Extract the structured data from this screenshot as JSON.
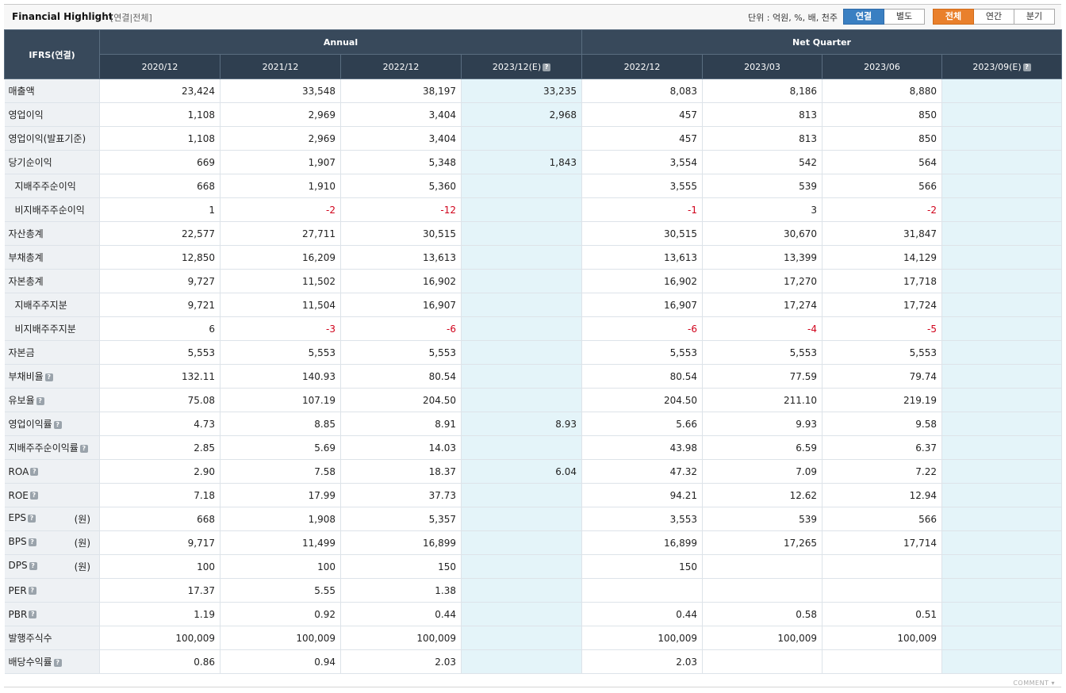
{
  "header": {
    "title": "Financial Highlight",
    "subtitle": "[연결|전체]",
    "unit_text": "단위 : 억원, %, 배, 천주",
    "consolidation_buttons": [
      "연결",
      "별도"
    ],
    "period_buttons": [
      "전체",
      "연간",
      "분기"
    ]
  },
  "table": {
    "corner_label": "IFRS(연결)",
    "group_annual": "Annual",
    "group_quarter": "Net Quarter",
    "columns": [
      "2020/12",
      "2021/12",
      "2022/12",
      "2023/12(E)",
      "2022/12",
      "2023/03",
      "2023/06",
      "2023/09(E)"
    ],
    "rows": [
      {
        "label": "매출액",
        "values": [
          "23,424",
          "33,548",
          "38,197",
          "33,235",
          "8,083",
          "8,186",
          "8,880",
          ""
        ]
      },
      {
        "label": "영업이익",
        "values": [
          "1,108",
          "2,969",
          "3,404",
          "2,968",
          "457",
          "813",
          "850",
          ""
        ]
      },
      {
        "label": "영업이익(발표기준)",
        "values": [
          "1,108",
          "2,969",
          "3,404",
          "",
          "457",
          "813",
          "850",
          ""
        ]
      },
      {
        "label": "당기순이익",
        "values": [
          "669",
          "1,907",
          "5,348",
          "1,843",
          "3,554",
          "542",
          "564",
          ""
        ]
      },
      {
        "label": "지배주주순이익",
        "values": [
          "668",
          "1,910",
          "5,360",
          "",
          "3,555",
          "539",
          "566",
          ""
        ]
      },
      {
        "label": "비지배주주순이익",
        "values": [
          "1",
          "-2",
          "-12",
          "",
          "-1",
          "3",
          "-2",
          ""
        ]
      },
      {
        "label": "자산총계",
        "values": [
          "22,577",
          "27,711",
          "30,515",
          "",
          "30,515",
          "30,670",
          "31,847",
          ""
        ]
      },
      {
        "label": "부채총계",
        "values": [
          "12,850",
          "16,209",
          "13,613",
          "",
          "13,613",
          "13,399",
          "14,129",
          ""
        ]
      },
      {
        "label": "자본총계",
        "values": [
          "9,727",
          "11,502",
          "16,902",
          "",
          "16,902",
          "17,270",
          "17,718",
          ""
        ]
      },
      {
        "label": "지배주주지분",
        "values": [
          "9,721",
          "11,504",
          "16,907",
          "",
          "16,907",
          "17,274",
          "17,724",
          ""
        ]
      },
      {
        "label": "비지배주주지분",
        "values": [
          "6",
          "-3",
          "-6",
          "",
          "-6",
          "-4",
          "-5",
          ""
        ]
      },
      {
        "label": "자본금",
        "values": [
          "5,553",
          "5,553",
          "5,553",
          "",
          "5,553",
          "5,553",
          "5,553",
          ""
        ]
      },
      {
        "label": "부채비율",
        "values": [
          "132.11",
          "140.93",
          "80.54",
          "",
          "80.54",
          "77.59",
          "79.74",
          ""
        ]
      },
      {
        "label": "유보율",
        "values": [
          "75.08",
          "107.19",
          "204.50",
          "",
          "204.50",
          "211.10",
          "219.19",
          ""
        ]
      },
      {
        "label": "영업이익률",
        "values": [
          "4.73",
          "8.85",
          "8.91",
          "8.93",
          "5.66",
          "9.93",
          "9.58",
          ""
        ]
      },
      {
        "label": "지배주주순이익률",
        "values": [
          "2.85",
          "5.69",
          "14.03",
          "",
          "43.98",
          "6.59",
          "6.37",
          ""
        ]
      },
      {
        "label": "ROA",
        "values": [
          "2.90",
          "7.58",
          "18.37",
          "6.04",
          "47.32",
          "7.09",
          "7.22",
          ""
        ]
      },
      {
        "label": "ROE",
        "values": [
          "7.18",
          "17.99",
          "37.73",
          "",
          "94.21",
          "12.62",
          "12.94",
          ""
        ]
      },
      {
        "label": "EPS",
        "unit": "(원)",
        "values": [
          "668",
          "1,908",
          "5,357",
          "",
          "3,553",
          "539",
          "566",
          ""
        ]
      },
      {
        "label": "BPS",
        "unit": "(원)",
        "values": [
          "9,717",
          "11,499",
          "16,899",
          "",
          "16,899",
          "17,265",
          "17,714",
          ""
        ]
      },
      {
        "label": "DPS",
        "unit": "(원)",
        "values": [
          "100",
          "100",
          "150",
          "",
          "150",
          "",
          "",
          ""
        ]
      },
      {
        "label": "PER",
        "values": [
          "17.37",
          "5.55",
          "1.38",
          "",
          "",
          "",
          "",
          ""
        ]
      },
      {
        "label": "PBR",
        "values": [
          "1.19",
          "0.92",
          "0.44",
          "",
          "0.44",
          "0.58",
          "0.51",
          ""
        ]
      },
      {
        "label": "발행주식수",
        "values": [
          "100,009",
          "100,009",
          "100,009",
          "",
          "100,009",
          "100,009",
          "100,009",
          ""
        ]
      },
      {
        "label": "배당수익률",
        "values": [
          "0.86",
          "0.94",
          "2.03",
          "",
          "2.03",
          "",
          "",
          ""
        ]
      }
    ]
  },
  "footer": {
    "comment_label": "COMMENT ▾"
  },
  "colors": {
    "header_bg": "#38495b",
    "estimate_bg": "#e4f4f9",
    "negative": "#d0021b",
    "blue_button": "#3a7fc2",
    "orange_button": "#e9802c"
  }
}
